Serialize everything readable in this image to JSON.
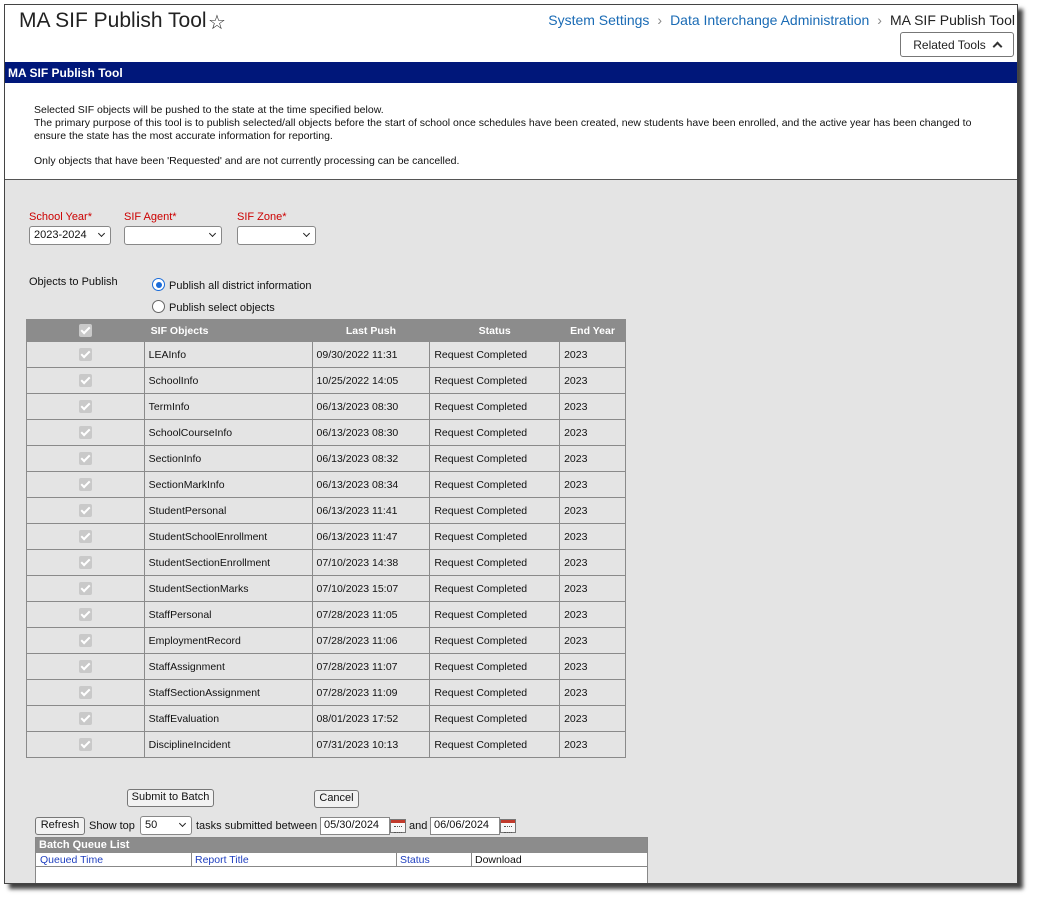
{
  "header": {
    "title": "MA SIF Publish Tool",
    "breadcrumb": [
      "System Settings",
      "Data Interchange Administration",
      "MA SIF Publish Tool"
    ],
    "related_tools": "Related Tools"
  },
  "section_title": "MA SIF Publish Tool",
  "description": {
    "line1": "Selected SIF objects will be pushed to the state at the time specified below.",
    "line2": "The primary purpose of this tool is to publish selected/all objects before the start of school once schedules have been created, new students have been enrolled, and the active year has been changed to ensure the state has the most accurate information for reporting.",
    "line3": "Only objects that have been 'Requested' and are not currently processing can be cancelled."
  },
  "filters": {
    "school_year_label": "School Year*",
    "school_year_value": "2023-2024",
    "sif_agent_label": "SIF Agent*",
    "sif_agent_value": "",
    "sif_zone_label": "SIF Zone*",
    "sif_zone_value": ""
  },
  "publish": {
    "label": "Objects to Publish",
    "option_all": "Publish all district information",
    "option_select": "Publish select objects",
    "selected": "all"
  },
  "table": {
    "columns": [
      "SIF Objects",
      "Last Push",
      "Status",
      "End Year"
    ],
    "rows": [
      {
        "object": "LEAInfo",
        "last_push": "09/30/2022 11:31",
        "status": "Request Completed",
        "end_year": "2023"
      },
      {
        "object": "SchoolInfo",
        "last_push": "10/25/2022 14:05",
        "status": "Request Completed",
        "end_year": "2023"
      },
      {
        "object": "TermInfo",
        "last_push": "06/13/2023 08:30",
        "status": "Request Completed",
        "end_year": "2023"
      },
      {
        "object": "SchoolCourseInfo",
        "last_push": "06/13/2023 08:30",
        "status": "Request Completed",
        "end_year": "2023"
      },
      {
        "object": "SectionInfo",
        "last_push": "06/13/2023 08:32",
        "status": "Request Completed",
        "end_year": "2023"
      },
      {
        "object": "SectionMarkInfo",
        "last_push": "06/13/2023 08:34",
        "status": "Request Completed",
        "end_year": "2023"
      },
      {
        "object": "StudentPersonal",
        "last_push": "06/13/2023 11:41",
        "status": "Request Completed",
        "end_year": "2023"
      },
      {
        "object": "StudentSchoolEnrollment",
        "last_push": "06/13/2023 11:47",
        "status": "Request Completed",
        "end_year": "2023"
      },
      {
        "object": "StudentSectionEnrollment",
        "last_push": "07/10/2023 14:38",
        "status": "Request Completed",
        "end_year": "2023"
      },
      {
        "object": "StudentSectionMarks",
        "last_push": "07/10/2023 15:07",
        "status": "Request Completed",
        "end_year": "2023"
      },
      {
        "object": "StaffPersonal",
        "last_push": "07/28/2023 11:05",
        "status": "Request Completed",
        "end_year": "2023"
      },
      {
        "object": "EmploymentRecord",
        "last_push": "07/28/2023 11:06",
        "status": "Request Completed",
        "end_year": "2023"
      },
      {
        "object": "StaffAssignment",
        "last_push": "07/28/2023 11:07",
        "status": "Request Completed",
        "end_year": "2023"
      },
      {
        "object": "StaffSectionAssignment",
        "last_push": "07/28/2023 11:09",
        "status": "Request Completed",
        "end_year": "2023"
      },
      {
        "object": "StaffEvaluation",
        "last_push": "08/01/2023 17:52",
        "status": "Request Completed",
        "end_year": "2023"
      },
      {
        "object": "DisciplineIncident",
        "last_push": "07/31/2023 10:13",
        "status": "Request Completed",
        "end_year": "2023"
      }
    ]
  },
  "actions": {
    "submit": "Submit to Batch",
    "cancel": "Cancel"
  },
  "batch": {
    "refresh": "Refresh",
    "show_top": "Show top",
    "top_value": "50",
    "tasks_between": "tasks submitted between",
    "start_date": "05/30/2024",
    "and": "and",
    "end_date": "06/06/2024",
    "queue_title": "Batch Queue List",
    "columns": [
      "Queued Time",
      "Report Title",
      "Status",
      "Download"
    ]
  }
}
